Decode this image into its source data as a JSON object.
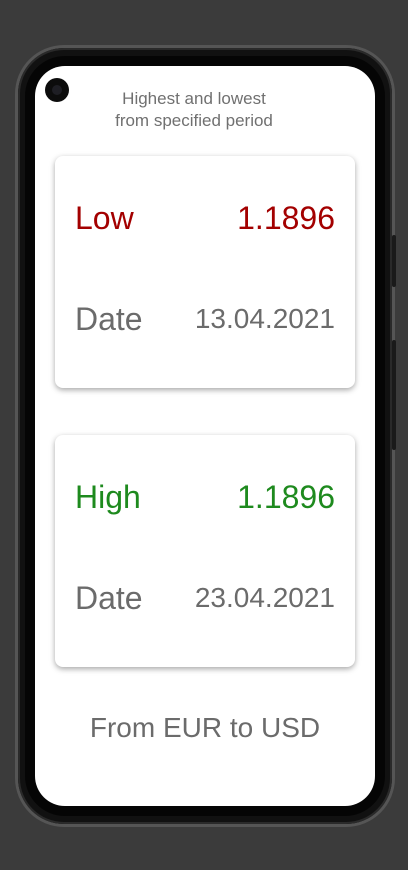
{
  "header": {
    "line1": "Highest and lowest",
    "line2": "from specified period"
  },
  "low_card": {
    "label": "Low",
    "value": "1.1896",
    "date_label": "Date",
    "date_value": "13.04.2021",
    "color": "#a30000"
  },
  "high_card": {
    "label": "High",
    "value": "1.1896",
    "date_label": "Date",
    "date_value": "23.04.2021",
    "color": "#1e8a1e"
  },
  "footer": {
    "text": "From EUR to USD"
  }
}
